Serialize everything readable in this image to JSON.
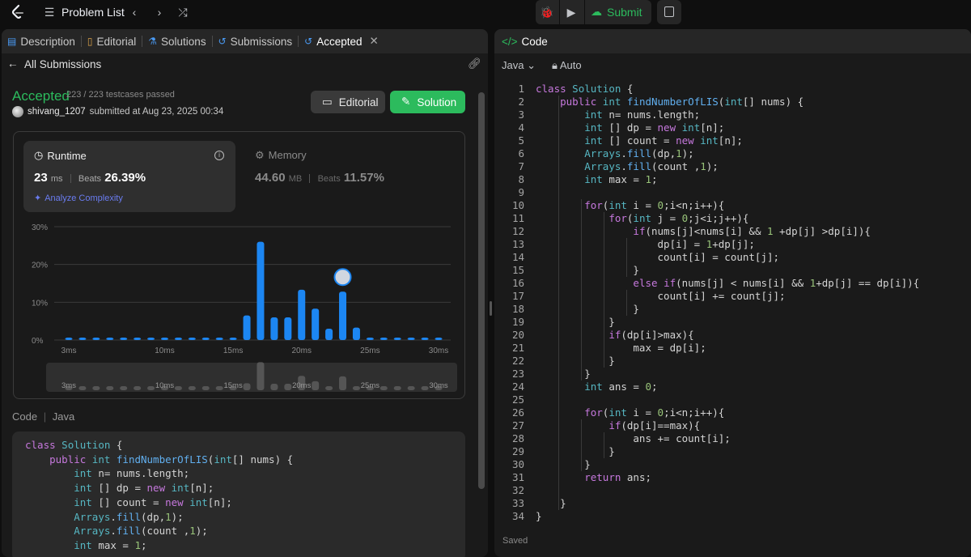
{
  "topbar": {
    "problem_list": "Problem List",
    "submit": "Submit"
  },
  "left": {
    "tabs": [
      {
        "label": "Description",
        "icon": "document-icon"
      },
      {
        "label": "Editorial",
        "icon": "book-icon"
      },
      {
        "label": "Solutions",
        "icon": "flask-icon"
      },
      {
        "label": "Submissions",
        "icon": "history-icon"
      },
      {
        "label": "Accepted",
        "icon": "history-icon"
      }
    ],
    "all_submissions": "All Submissions",
    "status": "Accepted",
    "testcases": "223 / 223 testcases passed",
    "username": "shivang_1207",
    "submitted_text": "submitted at Aug 23, 2025 00:34",
    "editorial_btn": "Editorial",
    "solution_btn": "Solution",
    "runtime": {
      "title": "Runtime",
      "value": "23",
      "unit": "ms",
      "beats_label": "Beats",
      "beats_value": "26.39%",
      "analyze": "Analyze Complexity"
    },
    "memory": {
      "title": "Memory",
      "value": "44.60",
      "unit": "MB",
      "beats_label": "Beats",
      "beats_value": "11.57%"
    },
    "code_label": "Code",
    "code_lang": "Java",
    "code_preview": [
      "class Solution {",
      "    public int findNumberOfLIS(int[] nums) {",
      "        int n= nums.length;",
      "        int [] dp = new int[n];",
      "        int [] count = new int[n];",
      "        Arrays.fill(dp,1);",
      "        Arrays.fill(count ,1);",
      "        int max = 1;"
    ]
  },
  "chart_data": {
    "type": "bar",
    "y_ticks": [
      "30%",
      "20%",
      "10%",
      "0%"
    ],
    "x_ticks": [
      "3ms",
      "10ms",
      "15ms",
      "20ms",
      "25ms",
      "30ms"
    ],
    "ylim": [
      0,
      30
    ],
    "x": [
      3,
      4,
      5,
      6,
      7,
      8,
      9,
      10,
      11,
      12,
      13,
      14,
      15,
      16,
      17,
      18,
      19,
      20,
      21,
      22,
      23,
      24,
      25,
      26,
      27,
      28,
      29,
      30
    ],
    "values": [
      0.5,
      0.5,
      0.5,
      0.5,
      0.5,
      0.5,
      0.5,
      0.5,
      0.5,
      0.5,
      0.5,
      0.5,
      0.5,
      6.5,
      26,
      6,
      6,
      13.3,
      8.3,
      3,
      12.8,
      3.3,
      0.5,
      0.5,
      0.5,
      0.5,
      0.5,
      0.5
    ],
    "highlight_x": 23,
    "bar_color": "#1c86f2"
  },
  "right": {
    "title": "Code",
    "language": "Java",
    "auto": "Auto",
    "saved": "Saved",
    "code": [
      "class Solution {",
      "    public int findNumberOfLIS(int[] nums) {",
      "        int n= nums.length;",
      "        int [] dp = new int[n];",
      "        int [] count = new int[n];",
      "        Arrays.fill(dp,1);",
      "        Arrays.fill(count ,1);",
      "        int max = 1;",
      "",
      "        for(int i = 0;i<n;i++){",
      "            for(int j = 0;j<i;j++){",
      "                if(nums[j]<nums[i] && 1 +dp[j] >dp[i]){",
      "                    dp[i] = 1+dp[j];",
      "                    count[i] = count[j];",
      "                }",
      "                else if(nums[j] < nums[i] && 1+dp[j] == dp[i]){",
      "                    count[i] += count[j];",
      "                }",
      "            }",
      "            if(dp[i]>max){",
      "                max = dp[i];",
      "            }",
      "        }",
      "        int ans = 0;",
      "",
      "        for(int i = 0;i<n;i++){",
      "            if(dp[i]==max){",
      "                ans += count[i];",
      "            }",
      "        }",
      "        return ans;",
      "",
      "    }",
      "}"
    ]
  }
}
